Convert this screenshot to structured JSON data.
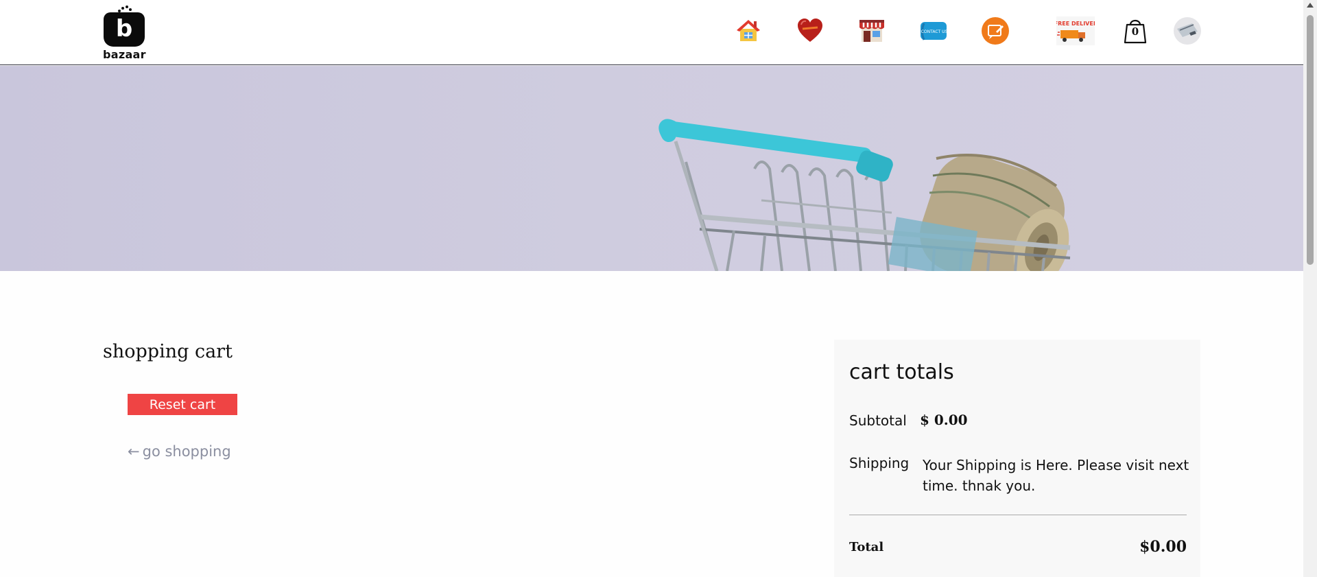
{
  "header": {
    "brand": "bazaar",
    "logo_letter": "b",
    "nav_icons": [
      "home-icon",
      "heart-icon",
      "store-icon",
      "contact-us-icon",
      "blog-icon",
      "free-delivery-icon",
      "cart-bag-icon",
      "account-icon"
    ],
    "contact_text": "CONTACT US",
    "free_delivery_text": "FREE DELIVERY",
    "cart_count": "0"
  },
  "hero": {
    "image": "shopping-cart-with-money-roll"
  },
  "cart": {
    "title": "shopping cart",
    "reset_label": "Reset cart",
    "go_shopping_arrow": "←",
    "go_shopping_label": "go shopping"
  },
  "totals": {
    "title": "cart totals",
    "subtotal_label": "Subtotal",
    "subtotal_value": "$ 0.00",
    "shipping_label": "Shipping",
    "shipping_value": "Your Shipping is Here. Please visit next time. thnak you.",
    "total_label": "Total",
    "total_value": "$0.00"
  },
  "colors": {
    "accent_red": "#ef4444",
    "hero_bg": "#cfccdf",
    "cart_handle": "#3cc6d8"
  }
}
